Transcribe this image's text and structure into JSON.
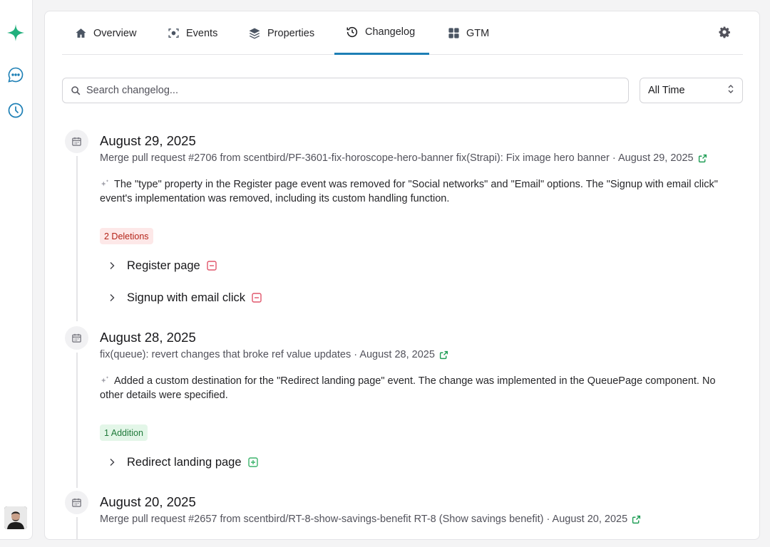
{
  "tabs": [
    {
      "label": "Overview",
      "icon": "home-icon"
    },
    {
      "label": "Events",
      "icon": "target-icon"
    },
    {
      "label": "Properties",
      "icon": "layers-icon"
    },
    {
      "label": "Changelog",
      "icon": "history-icon",
      "active": true
    },
    {
      "label": "GTM",
      "icon": "grid-icon"
    }
  ],
  "search": {
    "placeholder": "Search changelog..."
  },
  "time_filter": {
    "value": "All Time"
  },
  "colors": {
    "accent": "#1d7fb5",
    "deletion": "#e0566b",
    "addition": "#3cb36b",
    "logo": "#22b07d"
  },
  "entries": [
    {
      "date": "August 29, 2025",
      "commit": "Merge pull request #2706 from scentbird/PF-3601-fix-horoscope-hero-banner fix(Strapi): Fix image hero banner · August 29, 2025",
      "summary": "The \"type\" property in the Register page event was removed for \"Social networks\" and \"Email\" options. The \"Signup with email click\" event's implementation was removed, including its custom handling function.",
      "badge": "2 Deletions",
      "items": [
        "Register page",
        "Signup with email click"
      ]
    },
    {
      "date": "August 28, 2025",
      "commit": "fix(queue): revert changes that broke ref value updates · August 28, 2025",
      "summary": "Added a custom destination for the \"Redirect landing page\" event. The change was implemented in the QueuePage component. No other details were specified.",
      "badge": "1 Addition",
      "items": [
        "Redirect landing page"
      ]
    },
    {
      "date": "August 20, 2025",
      "commit": "Merge pull request #2657 from scentbird/RT-8-show-savings-benefit RT-8 (Show savings benefit) · August 20, 2025"
    }
  ]
}
